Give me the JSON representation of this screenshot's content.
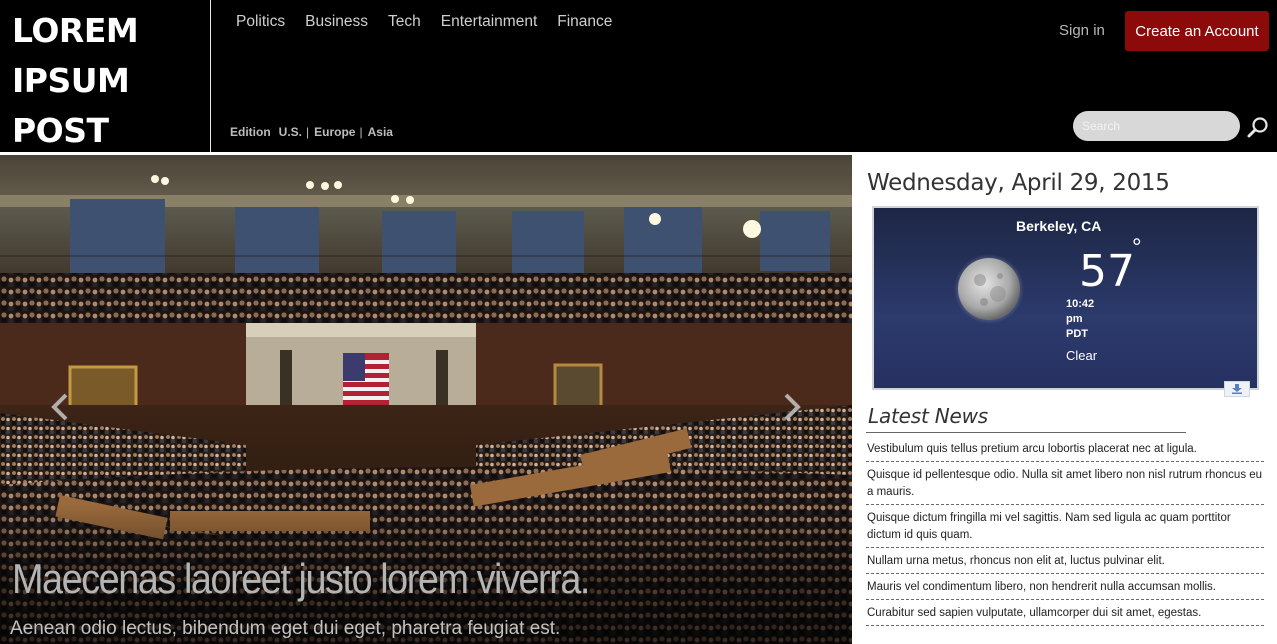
{
  "brand": {
    "line1": "LOREM",
    "line2": "IPSUM",
    "line3": "POST"
  },
  "nav": {
    "items": [
      {
        "label": "Politics"
      },
      {
        "label": "Business"
      },
      {
        "label": "Tech"
      },
      {
        "label": "Entertainment"
      },
      {
        "label": "Finance"
      }
    ]
  },
  "edition": {
    "label": "Edition",
    "items": [
      {
        "label": "U.S."
      },
      {
        "label": "Europe"
      },
      {
        "label": "Asia"
      }
    ],
    "separator": "|"
  },
  "account": {
    "signin_label": "Sign in",
    "create_label": "Create an Account"
  },
  "search": {
    "placeholder": "Search",
    "value": "",
    "icon": "search-icon"
  },
  "hero": {
    "title": "Maecenas laoreet justo lorem viverra.",
    "subtitle": "Aenean odio lectus, bibendum eget dui eget, pharetra feugiat est.",
    "prev_icon": "chevron-left-icon",
    "next_icon": "chevron-right-icon"
  },
  "sidebar": {
    "date": "Wednesday, April 29, 2015",
    "weather": {
      "city": "Berkeley, CA",
      "temperature": "57",
      "degree_symbol": "°",
      "time": "10:42",
      "ampm": "pm",
      "timezone": "PDT",
      "condition": "Clear",
      "condition_icon": "moon-icon",
      "download_icon": "download-icon"
    },
    "latest_title": "Latest News",
    "news": [
      {
        "text": "Vestibulum quis tellus pretium arcu lobortis placerat nec at ligula."
      },
      {
        "text": "Quisque id pellentesque odio. Nulla sit amet libero non nisl rutrum rhoncus eu a mauris."
      },
      {
        "text": "Quisque dictum fringilla mi vel sagittis. Nam sed ligula ac quam porttitor dictum id quis quam."
      },
      {
        "text": "Nullam urna metus, rhoncus non elit at, luctus pulvinar elit."
      },
      {
        "text": "Mauris vel condimentum libero, non hendrerit nulla accumsan mollis."
      },
      {
        "text": "Curabitur sed sapien vulputate, ullamcorper dui sit amet, egestas."
      }
    ]
  },
  "colors": {
    "header_bg": "#000000",
    "accent_button": "#8c0a0a",
    "weather_bg": "#263160",
    "nav_text": "#cfcfcf"
  }
}
